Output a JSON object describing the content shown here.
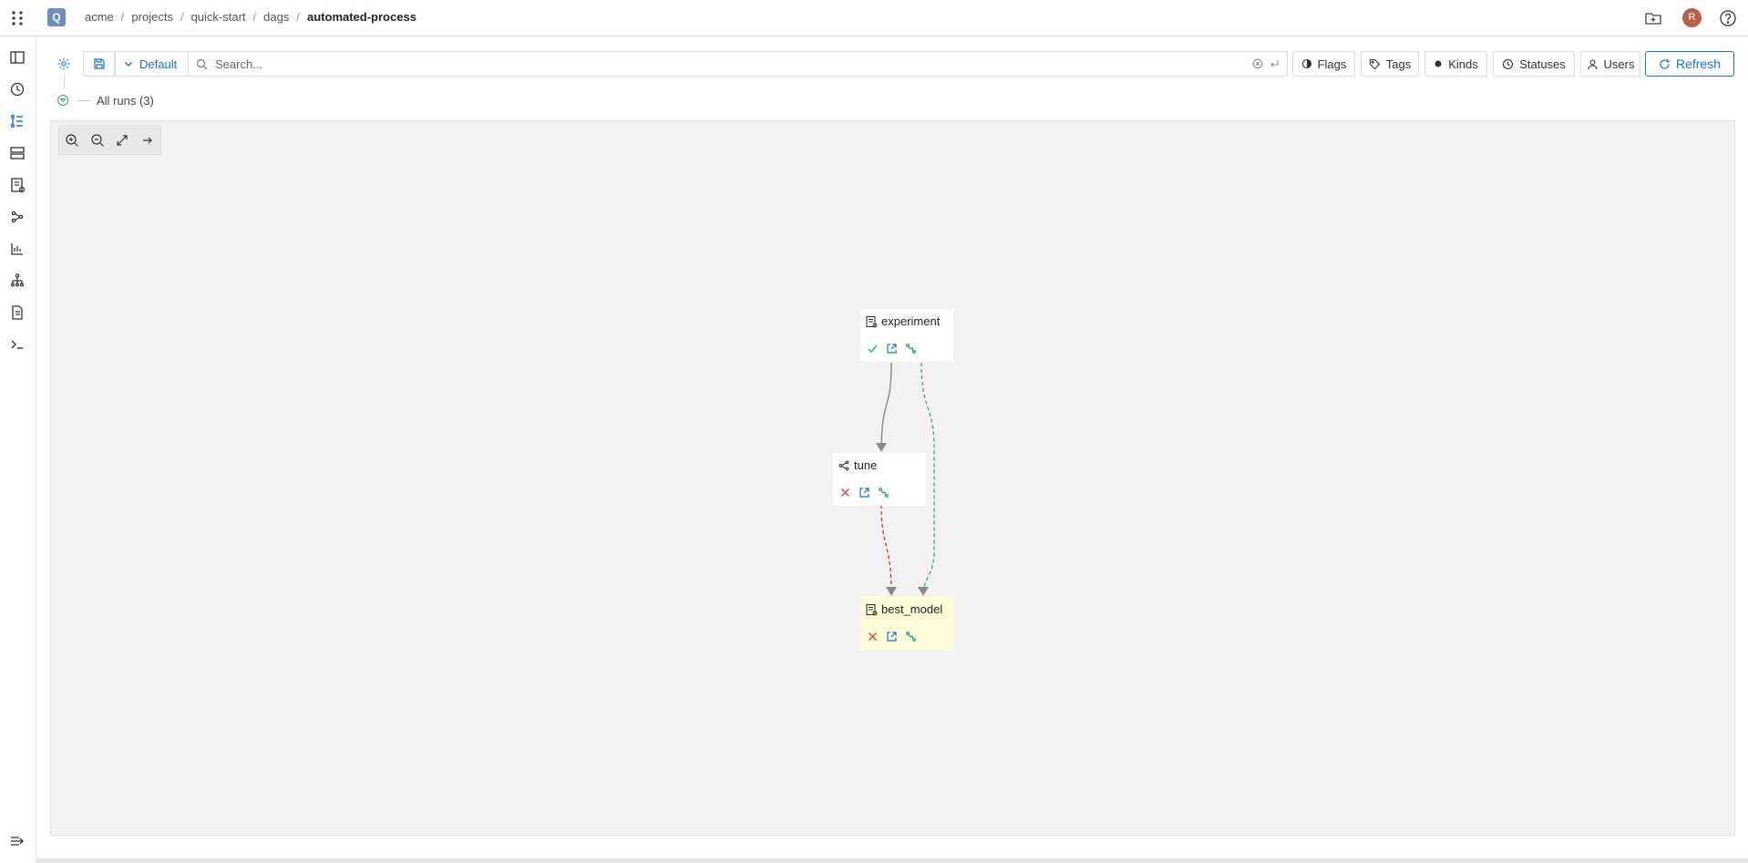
{
  "header": {
    "logo_letter": "Q",
    "breadcrumb": [
      "acme",
      "projects",
      "quick-start",
      "dags",
      "automated-process"
    ],
    "avatar_letter": "R"
  },
  "sidebar": {
    "items": [
      "book-icon",
      "history-icon",
      "dag-icon",
      "table-icon",
      "checklist-icon",
      "branch-icon",
      "chart-icon",
      "hierarchy-icon",
      "document-icon",
      "terminal-icon"
    ],
    "active_index": 2
  },
  "toolbar": {
    "preset_label": "Default",
    "search_placeholder": "Search...",
    "filters": {
      "flags": "Flags",
      "tags": "Tags",
      "kinds": "Kinds",
      "statuses": "Statuses",
      "users": "Users"
    },
    "refresh_label": "Refresh"
  },
  "runs_filter": {
    "label": "All runs (3)"
  },
  "dag": {
    "nodes": [
      {
        "id": "experiment",
        "label": "experiment",
        "kind": "operation",
        "status": "succeeded"
      },
      {
        "id": "tune",
        "label": "tune",
        "kind": "matrix",
        "status": "failed"
      },
      {
        "id": "best_model",
        "label": "best_model",
        "kind": "operation",
        "status": "failed",
        "highlighted": true
      }
    ],
    "edges": [
      {
        "from": "experiment",
        "to": "tune",
        "style": "solid",
        "color": "#8a8a8a"
      },
      {
        "from": "experiment",
        "to": "best_model",
        "style": "dashed",
        "color": "#3aa57a"
      },
      {
        "from": "tune",
        "to": "best_model",
        "style": "dashed",
        "color": "#c0392b"
      }
    ]
  },
  "colors": {
    "accent": "#1a73c9",
    "success": "#3aa57a",
    "danger": "#d9453a",
    "highlight": "#fdfbd8"
  }
}
